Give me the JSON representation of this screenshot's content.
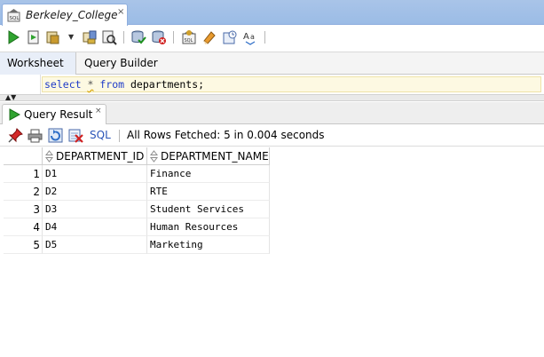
{
  "window": {
    "tab_title": "Berkeley_College",
    "tab_close": "×"
  },
  "subtabs": {
    "worksheet": "Worksheet",
    "query_builder": "Query Builder"
  },
  "editor": {
    "sql_select": "select",
    "sql_star": "*",
    "sql_from": "from",
    "sql_table": "departments;"
  },
  "result": {
    "tab_label": "Query Result",
    "tab_close": "×",
    "sql_link": "SQL",
    "status": "All Rows Fetched: 5 in 0.004 seconds"
  },
  "grid": {
    "columns": [
      "DEPARTMENT_ID",
      "DEPARTMENT_NAME"
    ],
    "rows": [
      {
        "num": "1",
        "id": "D1",
        "name": "Finance"
      },
      {
        "num": "2",
        "id": "D2",
        "name": "RTE"
      },
      {
        "num": "3",
        "id": "D3",
        "name": "Student Services"
      },
      {
        "num": "4",
        "id": "D4",
        "name": "Human Resources"
      },
      {
        "num": "5",
        "id": "D5",
        "name": "Marketing"
      }
    ]
  },
  "colors": {
    "accent_tab": "#9bbce6",
    "keyword": "#1f3cc8",
    "link": "#2a54b8",
    "editor_highlight": "#fdf9e2"
  },
  "icons": [
    "sql-file-icon",
    "run-statement-icon",
    "run-script-icon",
    "autotrace-icon",
    "explain-plan-icon",
    "sql-tuning-icon",
    "commit-icon",
    "rollback-icon",
    "sql-history-icon",
    "clear-icon",
    "format-icon",
    "case-icon",
    "pin-icon",
    "print-icon",
    "refresh-icon",
    "delete-icon",
    "sort-icon"
  ]
}
